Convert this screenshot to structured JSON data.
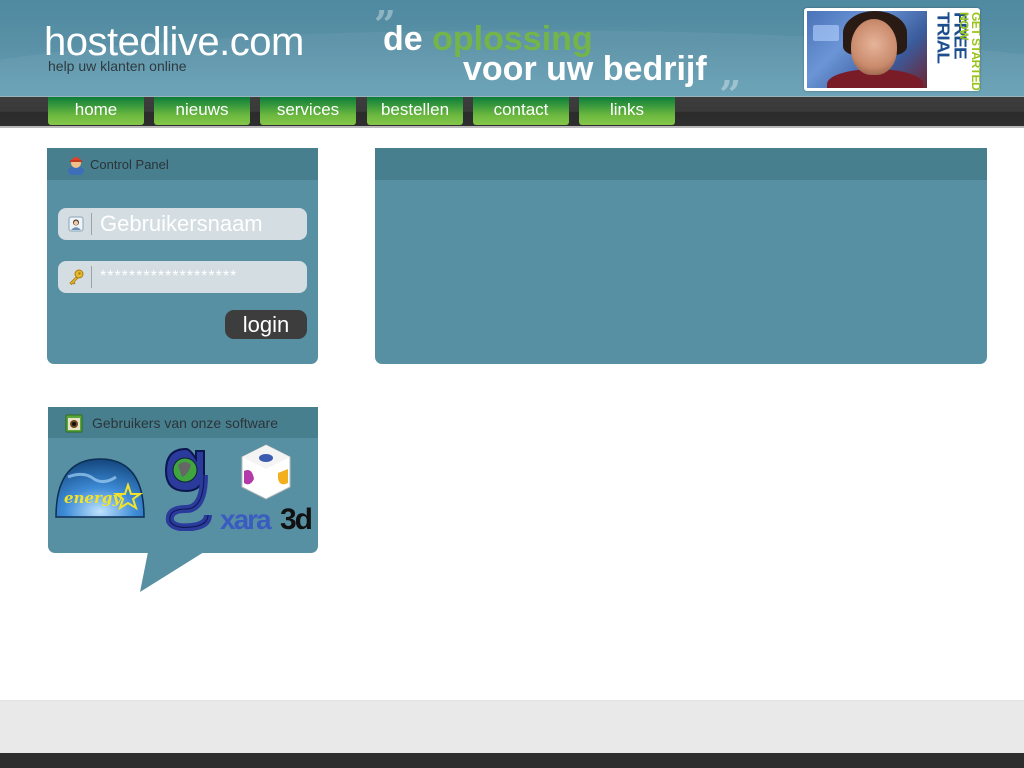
{
  "header": {
    "logo": "hostedlive.com",
    "tagline": "help uw klanten online",
    "slogan": {
      "open_quote": "”",
      "line1_white": "de ",
      "line1_green": "oplossing",
      "line2": "voor uw bedrijf",
      "close_quote": "„"
    },
    "trial_banner": {
      "main": "FREE TRIAL",
      "sub": "GET STARTED NOW",
      "icon": "support-agent-photo"
    }
  },
  "nav": {
    "items": [
      {
        "label": "home"
      },
      {
        "label": "nieuws"
      },
      {
        "label": "services"
      },
      {
        "label": "bestellen"
      },
      {
        "label": "contact"
      },
      {
        "label": "links"
      }
    ]
  },
  "control_panel": {
    "title": "Control Panel",
    "icon": "user-icon",
    "username": {
      "value": "Gebruikersnaam",
      "icon": "user-field-icon"
    },
    "password": {
      "value": "*******************",
      "icon": "key-icon"
    },
    "login_label": "login"
  },
  "software_panel": {
    "title": "Gebruikers van onze software",
    "icon": "software-box-icon",
    "logos": [
      {
        "name": "Energy Star",
        "text": "energy"
      },
      {
        "name": "G globe logo",
        "text": "g"
      },
      {
        "name": "Xara3D",
        "text": "xara3d"
      }
    ]
  },
  "colors": {
    "header_blue": "#5990a6",
    "panel_blue": "#5890a3",
    "panel_head": "#477f8f",
    "nav_green": "#6cb83f",
    "slogan_green": "#73b54a",
    "nav_dark": "#333333",
    "footer_light": "#e9e9e9",
    "footer_dark": "#2d2d2d"
  }
}
